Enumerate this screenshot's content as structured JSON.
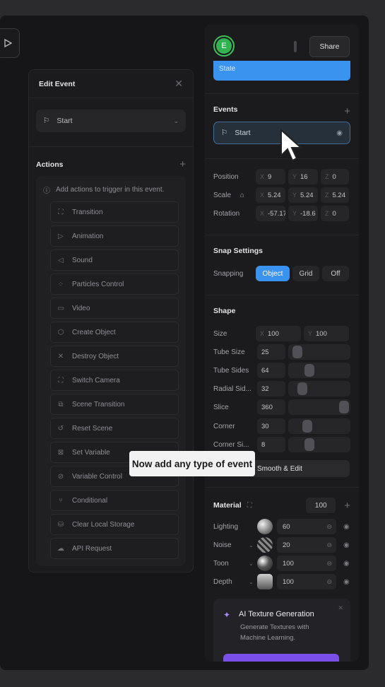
{
  "edit_event": {
    "title": "Edit Event",
    "selected_event": "Start",
    "actions_title": "Actions",
    "hint": "Add actions to trigger in this event.",
    "actions": [
      {
        "label": "Transition",
        "icon": "transition-icon",
        "glyph": "⛶"
      },
      {
        "label": "Animation",
        "icon": "play-icon",
        "glyph": "▷"
      },
      {
        "label": "Sound",
        "icon": "sound-icon",
        "glyph": "◁"
      },
      {
        "label": "Particles Control",
        "icon": "particles-icon",
        "glyph": "⁘"
      },
      {
        "label": "Video",
        "icon": "video-icon",
        "glyph": "▭"
      },
      {
        "label": "Create Object",
        "icon": "cube-icon",
        "glyph": "⬡"
      },
      {
        "label": "Destroy Object",
        "icon": "x-icon",
        "glyph": "✕"
      },
      {
        "label": "Switch Camera",
        "icon": "camera-frame-icon",
        "glyph": "⛶"
      },
      {
        "label": "Scene Transition",
        "icon": "scene-icon",
        "glyph": "⧉"
      },
      {
        "label": "Reset Scene",
        "icon": "reset-icon",
        "glyph": "↺"
      },
      {
        "label": "Set Variable",
        "icon": "variable-icon",
        "glyph": "⊠"
      },
      {
        "label": "Variable Control",
        "icon": "variable-control-icon",
        "glyph": "⊘"
      },
      {
        "label": "Conditional",
        "icon": "branch-icon",
        "glyph": "⑂"
      },
      {
        "label": "Clear Local Storage",
        "icon": "database-icon",
        "glyph": "⛁"
      },
      {
        "label": "API Request",
        "icon": "cloud-icon",
        "glyph": "☁"
      }
    ]
  },
  "header": {
    "avatar_letter": "E",
    "share_label": "Share",
    "state_label": "State"
  },
  "events": {
    "title": "Events",
    "item": "Start"
  },
  "transform": {
    "position": {
      "label": "Position",
      "x": "9",
      "y": "16",
      "z": "0"
    },
    "scale": {
      "label": "Scale",
      "x": "5.24",
      "y": "5.24",
      "z": "5.24"
    },
    "rotation": {
      "label": "Rotation",
      "x": "-57.17",
      "y": "-18.6",
      "z": "0"
    },
    "axis": {
      "x": "X",
      "y": "Y",
      "z": "Z"
    }
  },
  "snap": {
    "title": "Snap Settings",
    "label": "Snapping",
    "options": [
      "Object",
      "Grid",
      "Off"
    ],
    "selected": "Object"
  },
  "shape": {
    "title": "Shape",
    "size": {
      "label": "Size",
      "x": "100",
      "y": "100"
    },
    "sliders": [
      {
        "label": "Tube Size",
        "value": "25",
        "fraction": 0.05
      },
      {
        "label": "Tube Sides",
        "value": "64",
        "fraction": 0.3
      },
      {
        "label": "Radial Sid...",
        "value": "32",
        "fraction": 0.15
      },
      {
        "label": "Slice",
        "value": "360",
        "fraction": 1.0
      },
      {
        "label": "Corner",
        "value": "30",
        "fraction": 0.25
      },
      {
        "label": "Corner Si...",
        "value": "8",
        "fraction": 0.3
      }
    ],
    "smooth_label": "Smooth & Edit"
  },
  "material": {
    "title": "Material",
    "opacity": "100",
    "rows": [
      {
        "label": "Lighting",
        "value": "60",
        "has_chevron": false
      },
      {
        "label": "Noise",
        "value": "20",
        "has_chevron": true
      },
      {
        "label": "Toon",
        "value": "100",
        "has_chevron": true
      },
      {
        "label": "Depth",
        "value": "100",
        "has_chevron": true
      }
    ]
  },
  "ai_texture": {
    "title": "AI Texture Generation",
    "description": "Generate Textures with Machine Learning."
  },
  "tooltip": "Now add any type of event",
  "colors": {
    "accent": "#3b93f0",
    "avatar": "#32b251",
    "ai_button": "#7a4ee8"
  }
}
